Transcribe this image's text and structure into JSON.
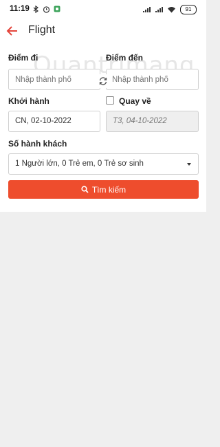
{
  "status": {
    "time": "11:19",
    "battery": "91"
  },
  "header": {
    "title": "Flight"
  },
  "form": {
    "origin_label": "Điểm đi",
    "origin_placeholder": "Nhập thành phố",
    "destination_label": "Điểm đến",
    "destination_placeholder": "Nhập thành phố",
    "depart_label": "Khởi hành",
    "depart_value": "CN, 02-10-2022",
    "return_label": "Quay về",
    "return_value": "T3, 04-10-2022",
    "return_checked": false,
    "passengers_label": "Số hành khách",
    "passengers_value": "1 Người lớn, 0 Trẻ em, 0 Trẻ sơ sinh",
    "search_label": "Tìm kiếm"
  },
  "watermark": "Quantrimang",
  "colors": {
    "accent": "#ee4d2d",
    "background": "#efefef"
  }
}
